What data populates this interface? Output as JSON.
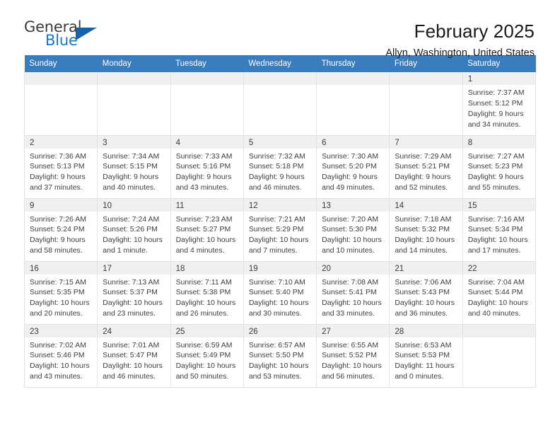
{
  "brand": {
    "name_top": "General",
    "name_bottom": "Blue",
    "accent_color": "#1a76c4",
    "triangle_color": "#1462ad"
  },
  "header": {
    "title": "February 2025",
    "location": "Allyn, Washington, United States"
  },
  "theme": {
    "header_row_bg": "#3a7dbf",
    "daynum_bg": "#f0f0f0",
    "grid_border": "#e2e2e2",
    "text": "#404040"
  },
  "calendar": {
    "weekday_headers": [
      "Sunday",
      "Monday",
      "Tuesday",
      "Wednesday",
      "Thursday",
      "Friday",
      "Saturday"
    ],
    "weeks": [
      [
        {
          "day": "",
          "empty": true
        },
        {
          "day": "",
          "empty": true
        },
        {
          "day": "",
          "empty": true
        },
        {
          "day": "",
          "empty": true
        },
        {
          "day": "",
          "empty": true
        },
        {
          "day": "",
          "empty": true
        },
        {
          "day": "1",
          "sunrise": "Sunrise: 7:37 AM",
          "sunset": "Sunset: 5:12 PM",
          "daylight": "Daylight: 9 hours and 34 minutes."
        }
      ],
      [
        {
          "day": "2",
          "sunrise": "Sunrise: 7:36 AM",
          "sunset": "Sunset: 5:13 PM",
          "daylight": "Daylight: 9 hours and 37 minutes."
        },
        {
          "day": "3",
          "sunrise": "Sunrise: 7:34 AM",
          "sunset": "Sunset: 5:15 PM",
          "daylight": "Daylight: 9 hours and 40 minutes."
        },
        {
          "day": "4",
          "sunrise": "Sunrise: 7:33 AM",
          "sunset": "Sunset: 5:16 PM",
          "daylight": "Daylight: 9 hours and 43 minutes."
        },
        {
          "day": "5",
          "sunrise": "Sunrise: 7:32 AM",
          "sunset": "Sunset: 5:18 PM",
          "daylight": "Daylight: 9 hours and 46 minutes."
        },
        {
          "day": "6",
          "sunrise": "Sunrise: 7:30 AM",
          "sunset": "Sunset: 5:20 PM",
          "daylight": "Daylight: 9 hours and 49 minutes."
        },
        {
          "day": "7",
          "sunrise": "Sunrise: 7:29 AM",
          "sunset": "Sunset: 5:21 PM",
          "daylight": "Daylight: 9 hours and 52 minutes."
        },
        {
          "day": "8",
          "sunrise": "Sunrise: 7:27 AM",
          "sunset": "Sunset: 5:23 PM",
          "daylight": "Daylight: 9 hours and 55 minutes."
        }
      ],
      [
        {
          "day": "9",
          "sunrise": "Sunrise: 7:26 AM",
          "sunset": "Sunset: 5:24 PM",
          "daylight": "Daylight: 9 hours and 58 minutes."
        },
        {
          "day": "10",
          "sunrise": "Sunrise: 7:24 AM",
          "sunset": "Sunset: 5:26 PM",
          "daylight": "Daylight: 10 hours and 1 minute."
        },
        {
          "day": "11",
          "sunrise": "Sunrise: 7:23 AM",
          "sunset": "Sunset: 5:27 PM",
          "daylight": "Daylight: 10 hours and 4 minutes."
        },
        {
          "day": "12",
          "sunrise": "Sunrise: 7:21 AM",
          "sunset": "Sunset: 5:29 PM",
          "daylight": "Daylight: 10 hours and 7 minutes."
        },
        {
          "day": "13",
          "sunrise": "Sunrise: 7:20 AM",
          "sunset": "Sunset: 5:30 PM",
          "daylight": "Daylight: 10 hours and 10 minutes."
        },
        {
          "day": "14",
          "sunrise": "Sunrise: 7:18 AM",
          "sunset": "Sunset: 5:32 PM",
          "daylight": "Daylight: 10 hours and 14 minutes."
        },
        {
          "day": "15",
          "sunrise": "Sunrise: 7:16 AM",
          "sunset": "Sunset: 5:34 PM",
          "daylight": "Daylight: 10 hours and 17 minutes."
        }
      ],
      [
        {
          "day": "16",
          "sunrise": "Sunrise: 7:15 AM",
          "sunset": "Sunset: 5:35 PM",
          "daylight": "Daylight: 10 hours and 20 minutes."
        },
        {
          "day": "17",
          "sunrise": "Sunrise: 7:13 AM",
          "sunset": "Sunset: 5:37 PM",
          "daylight": "Daylight: 10 hours and 23 minutes."
        },
        {
          "day": "18",
          "sunrise": "Sunrise: 7:11 AM",
          "sunset": "Sunset: 5:38 PM",
          "daylight": "Daylight: 10 hours and 26 minutes."
        },
        {
          "day": "19",
          "sunrise": "Sunrise: 7:10 AM",
          "sunset": "Sunset: 5:40 PM",
          "daylight": "Daylight: 10 hours and 30 minutes."
        },
        {
          "day": "20",
          "sunrise": "Sunrise: 7:08 AM",
          "sunset": "Sunset: 5:41 PM",
          "daylight": "Daylight: 10 hours and 33 minutes."
        },
        {
          "day": "21",
          "sunrise": "Sunrise: 7:06 AM",
          "sunset": "Sunset: 5:43 PM",
          "daylight": "Daylight: 10 hours and 36 minutes."
        },
        {
          "day": "22",
          "sunrise": "Sunrise: 7:04 AM",
          "sunset": "Sunset: 5:44 PM",
          "daylight": "Daylight: 10 hours and 40 minutes."
        }
      ],
      [
        {
          "day": "23",
          "sunrise": "Sunrise: 7:02 AM",
          "sunset": "Sunset: 5:46 PM",
          "daylight": "Daylight: 10 hours and 43 minutes."
        },
        {
          "day": "24",
          "sunrise": "Sunrise: 7:01 AM",
          "sunset": "Sunset: 5:47 PM",
          "daylight": "Daylight: 10 hours and 46 minutes."
        },
        {
          "day": "25",
          "sunrise": "Sunrise: 6:59 AM",
          "sunset": "Sunset: 5:49 PM",
          "daylight": "Daylight: 10 hours and 50 minutes."
        },
        {
          "day": "26",
          "sunrise": "Sunrise: 6:57 AM",
          "sunset": "Sunset: 5:50 PM",
          "daylight": "Daylight: 10 hours and 53 minutes."
        },
        {
          "day": "27",
          "sunrise": "Sunrise: 6:55 AM",
          "sunset": "Sunset: 5:52 PM",
          "daylight": "Daylight: 10 hours and 56 minutes."
        },
        {
          "day": "28",
          "sunrise": "Sunrise: 6:53 AM",
          "sunset": "Sunset: 5:53 PM",
          "daylight": "Daylight: 11 hours and 0 minutes."
        },
        {
          "day": "",
          "empty": true
        }
      ]
    ]
  }
}
